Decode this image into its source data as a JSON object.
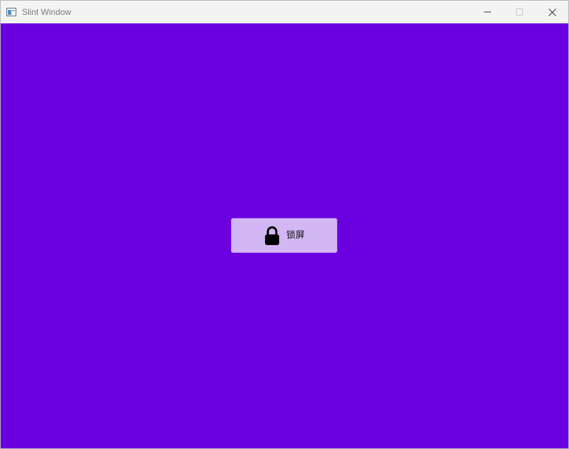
{
  "window": {
    "title": "Slint Window",
    "app_icon": "window-app-icon",
    "controls": {
      "minimize_icon": "minimize-icon",
      "maximize_icon": "maximize-icon",
      "close_icon": "close-icon"
    }
  },
  "main": {
    "background_color": "#6a00e0",
    "lock_button": {
      "label": "锁屏",
      "icon": "lock-icon",
      "background_color": "#d3b7f5"
    }
  }
}
